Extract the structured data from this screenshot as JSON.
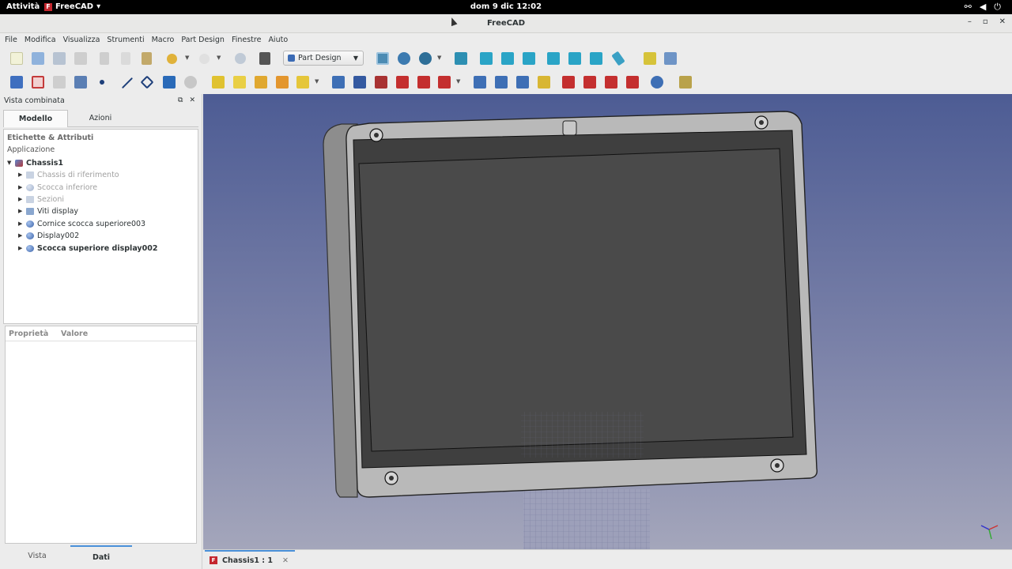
{
  "topbar": {
    "activities": "Attività",
    "app": "FreeCAD",
    "app_caret": "▾",
    "clock": "dom 9 dic  12:02"
  },
  "window": {
    "title": "FreeCAD",
    "min": "–",
    "max": "▫",
    "close": "✕"
  },
  "menubar": [
    "File",
    "Modifica",
    "Visualizza",
    "Strumenti",
    "Macro",
    "Part Design",
    "Finestre",
    "Aiuto"
  ],
  "workbench": {
    "selected": "Part Design",
    "caret": "▼"
  },
  "combo_view": {
    "title": "Vista combinata",
    "tabs": {
      "model": "Modello",
      "tasks": "Azioni"
    },
    "tree": {
      "header": "Etichette & Attributi",
      "application": "Applicazione",
      "root": "Chassis1",
      "items": [
        "Chassis di riferimento",
        "Scocca inferiore",
        "Sezioni",
        "Viti display",
        "Cornice scocca superiore003",
        "Display002",
        "Scocca superiore display002"
      ]
    },
    "properties": {
      "col_property": "Proprietà",
      "col_value": "Valore"
    },
    "bottom_tabs": {
      "view": "Vista",
      "data": "Dati"
    }
  },
  "view_tab": {
    "label": "Chassis1 : 1",
    "close": "✕"
  },
  "colors": {
    "brand": "#c4262e",
    "accent": "#4a90d9",
    "bg_top": "#4d5c94",
    "bg_bottom": "#a4a6bb"
  }
}
